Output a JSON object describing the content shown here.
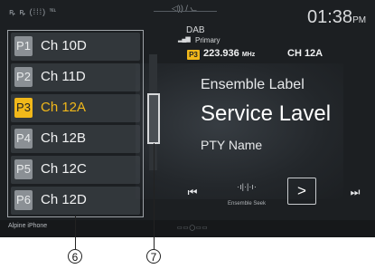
{
  "status": {
    "left_icons": "ꝶ ꝶ (⁞⁞⁞) ℡",
    "center_icons": "◁)) / ⦦",
    "time": "01:38",
    "ampm": "PM"
  },
  "presets": [
    {
      "num": "P1",
      "label": "Ch 10D",
      "active": false
    },
    {
      "num": "P2",
      "label": "Ch 11D",
      "active": false
    },
    {
      "num": "P3",
      "label": "Ch 12A",
      "active": true
    },
    {
      "num": "P4",
      "label": "Ch 12B",
      "active": false
    },
    {
      "num": "P5",
      "label": "Ch 12C",
      "active": false
    },
    {
      "num": "P6",
      "label": "Ch 12D",
      "active": false
    }
  ],
  "now_playing": {
    "band": "DAB",
    "signal_icon": "signal-strength",
    "primary_label": "Primary",
    "preset_badge": "P3",
    "frequency": "223.936",
    "frequency_unit": "MHz",
    "channel": "CH 12A",
    "ensemble_label": "Ensemble Label",
    "service_label": "Service Lavel",
    "pty_name": "PTY Name"
  },
  "controls": {
    "prev_symbol": "⏮",
    "seek_icon": "·ı|·|·ı·",
    "seek_label": "Ensemble Seek",
    "next_page_symbol": ">",
    "next_symbol": "⏭"
  },
  "footer": {
    "source": "Alpine iPhone",
    "page_dots": "▭▭◯▭▭"
  },
  "callouts": [
    "6",
    "7"
  ],
  "colors": {
    "accent": "#f1b81a",
    "screen_bg": "#1c1f22"
  }
}
